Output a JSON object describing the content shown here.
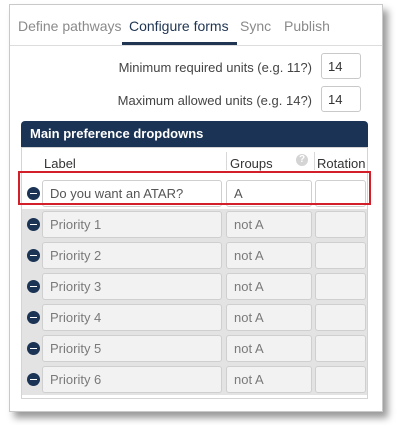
{
  "tabs": [
    {
      "label": "Define pathways",
      "active": false
    },
    {
      "label": "Configure forms",
      "active": true
    },
    {
      "label": "Sync",
      "active": false
    },
    {
      "label": "Publish",
      "active": false
    }
  ],
  "units": {
    "min_label": "Minimum required units (e.g. 11?)",
    "min_value": "14",
    "max_label": "Maximum allowed units (e.g. 14?)",
    "max_value": "14"
  },
  "section": {
    "title": "Main preference dropdowns"
  },
  "table": {
    "headers": {
      "label": "Label",
      "groups": "Groups",
      "rotation": "Rotation"
    },
    "rows": [
      {
        "label": "Do you want an ATAR?",
        "group": "A",
        "rotation": ""
      },
      {
        "label": "Priority 1",
        "group": "not A",
        "rotation": ""
      },
      {
        "label": "Priority 2",
        "group": "not A",
        "rotation": ""
      },
      {
        "label": "Priority 3",
        "group": "not A",
        "rotation": ""
      },
      {
        "label": "Priority 4",
        "group": "not A",
        "rotation": ""
      },
      {
        "label": "Priority 5",
        "group": "not A",
        "rotation": ""
      },
      {
        "label": "Priority 6",
        "group": "not A",
        "rotation": ""
      }
    ]
  },
  "colors": {
    "accent": "#1b3354",
    "highlight": "#d21f2a"
  },
  "icons": {
    "remove_row": "minus-circle-icon",
    "help": "question-icon"
  }
}
